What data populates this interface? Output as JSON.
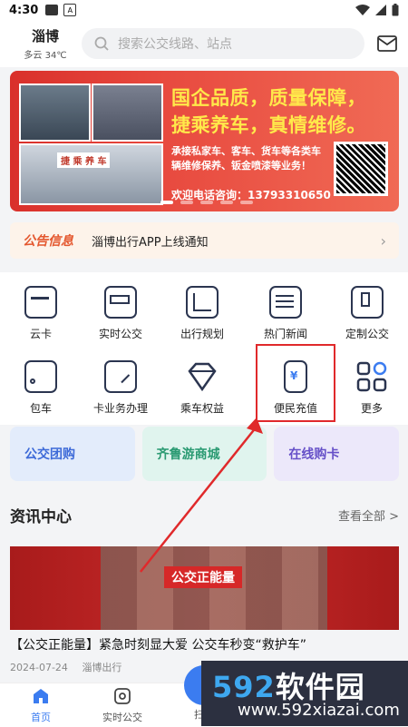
{
  "status": {
    "time": "4:30"
  },
  "header": {
    "city": "淄博",
    "weather": "多云 34℃",
    "search_placeholder": "搜索公交线路、站点"
  },
  "banner": {
    "headline1": "国企品质，质量保障，",
    "headline2": "捷乘养车，真情维修。",
    "sub1": "承接私家车、客车、货车等各类车",
    "sub2": "辆维修保养、钣金喷漆等业务！",
    "phone": "欢迎电话咨询：13793310650",
    "sign": "捷 乘 养 车"
  },
  "notice": {
    "tag": "公告信息",
    "text": "淄博出行APP上线通知"
  },
  "grid": [
    {
      "label": "云卡",
      "icon": "card-icon"
    },
    {
      "label": "实时公交",
      "icon": "bus-icon"
    },
    {
      "label": "出行规划",
      "icon": "route-map-icon"
    },
    {
      "label": "热门新闻",
      "icon": "news-icon"
    },
    {
      "label": "定制公交",
      "icon": "custom-bus-icon"
    },
    {
      "label": "包车",
      "icon": "charter-bus-icon"
    },
    {
      "label": "卡业务办理",
      "icon": "card-service-icon"
    },
    {
      "label": "乘车权益",
      "icon": "diamond-icon"
    },
    {
      "label": "便民充值",
      "icon": "recharge-icon"
    },
    {
      "label": "更多",
      "icon": "more-apps-icon"
    }
  ],
  "cards": [
    "公交团购",
    "齐鲁游商城",
    "在线购卡"
  ],
  "news_section": {
    "title": "资讯中心",
    "more": "查看全部 >"
  },
  "news": {
    "image_label": "公交正能量",
    "title": "【公交正能量】紧急时刻显大爱 公交车秒变“救护车”",
    "date": "2024-07-24",
    "source": "淄博出行"
  },
  "tabs": [
    "首页",
    "实时公交",
    "扫码"
  ],
  "watermark": {
    "big_num": "592",
    "big_cn": "软件园",
    "url": "www.592xiazai.com"
  },
  "colors": {
    "accent": "#3b7cf0",
    "highlight": "#e0292b",
    "banner": "#e03a33"
  }
}
